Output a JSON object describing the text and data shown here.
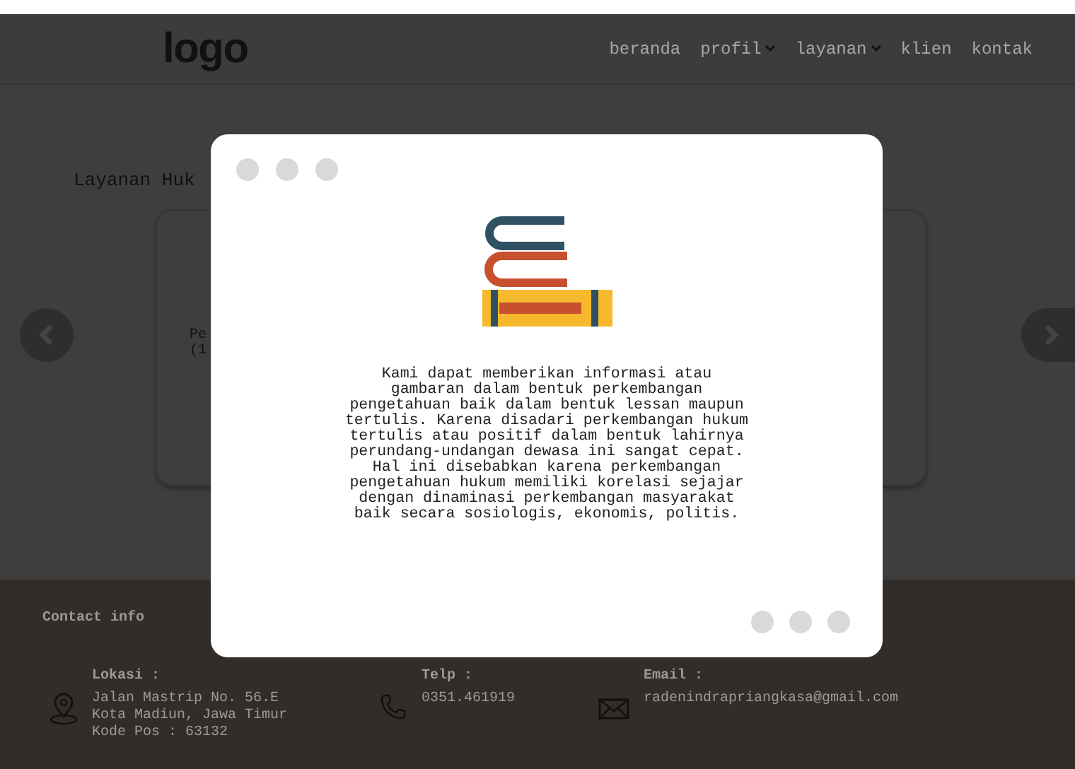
{
  "header": {
    "logo": "logo",
    "nav": [
      {
        "label": "beranda",
        "dropdown": false
      },
      {
        "label": "profil",
        "dropdown": true
      },
      {
        "label": "layanan",
        "dropdown": true
      },
      {
        "label": "klien",
        "dropdown": false
      },
      {
        "label": "kontak",
        "dropdown": false
      }
    ]
  },
  "section": {
    "title": "Layanan Huk",
    "card_lines": [
      "Pe",
      "(1"
    ]
  },
  "modal": {
    "paragraph": "Kami dapat memberikan informasi atau gambaran dalam bentuk perkembangan pengetahuan baik dalam bentuk lessan maupun tertulis. Karena disadari perkembangan hukum tertulis atau positif dalam bentuk lahirnya perundang-undangan dewasa ini sangat cepat. Hal ini disebabkan karena perkembangan pengetahuan hukum memiliki korelasi sejajar dengan dinaminasi perkembangan masyarakat baik secara sosiologis, ekonomis, politis."
  },
  "footer": {
    "heading": "Contact info",
    "items": [
      {
        "kind": "location",
        "label": "Lokasi :",
        "lines": [
          "Jalan Mastrip No. 56.E",
          "Kota Madiun, Jawa Timur",
          "Kode Pos : 63132"
        ]
      },
      {
        "kind": "phone",
        "label": "Telp :",
        "lines": [
          "0351.461919"
        ]
      },
      {
        "kind": "email",
        "label": "Email :",
        "lines": [
          "radenindrapriangkasa@gmail.com"
        ]
      }
    ]
  }
}
